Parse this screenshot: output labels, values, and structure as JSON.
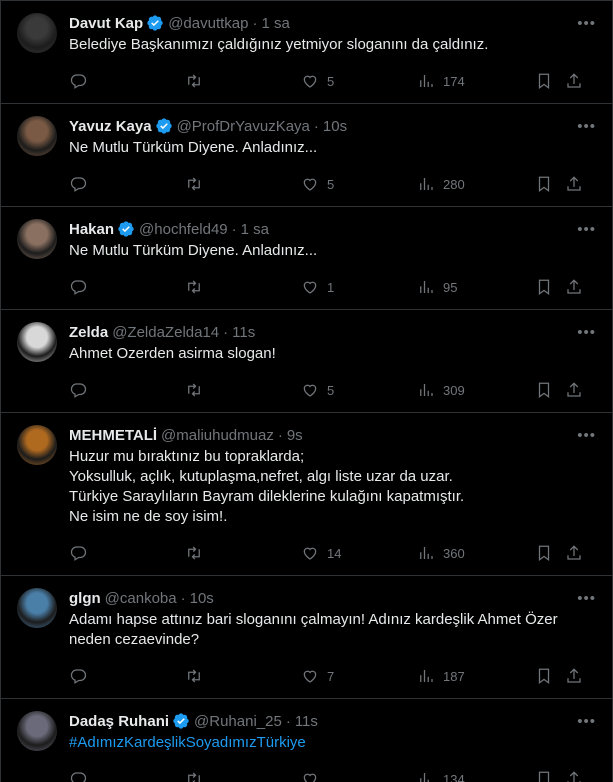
{
  "tweets": [
    {
      "name": "Davut Kap",
      "verified": true,
      "handle": "@davuttkap",
      "time": "1 sa",
      "text": "Belediye Başkanımızı çaldığınız yetmiyor sloganını da çaldınız.",
      "replies": "",
      "retweets": "",
      "likes": "5",
      "views": "174",
      "avatar_color": "#3a3a3a",
      "is_link": false
    },
    {
      "name": "Yavuz Kaya",
      "verified": true,
      "handle": "@ProfDrYavuzKaya",
      "time": "10s",
      "text": "Ne Mutlu Türküm Diyene. Anladınız...",
      "replies": "",
      "retweets": "",
      "likes": "5",
      "views": "280",
      "avatar_color": "#7a5a44",
      "is_link": false
    },
    {
      "name": "Hakan",
      "verified": true,
      "handle": "@hochfeld49",
      "time": "1 sa",
      "text": "Ne Mutlu Türküm Diyene. Anladınız...",
      "replies": "",
      "retweets": "",
      "likes": "1",
      "views": "95",
      "avatar_color": "#8a7060",
      "is_link": false
    },
    {
      "name": "Zelda",
      "verified": false,
      "handle": "@ZeldaZelda14",
      "time": "11s",
      "text": "Ahmet Ozerden asirma slogan!",
      "replies": "",
      "retweets": "",
      "likes": "5",
      "views": "309",
      "avatar_color": "#d8d8d8",
      "is_link": false
    },
    {
      "name": "MEHMETALİ",
      "verified": false,
      "handle": "@maliuhudmuaz",
      "time": "9s",
      "text": "Huzur mu bıraktınız bu topraklarda;\nYoksulluk, açlık, kutuplaşma,nefret, algı liste uzar da uzar.\nTürkiye Saraylıların Bayram dileklerine kulağını kapatmıştır.\nNe isim ne de soy isim!.",
      "replies": "",
      "retweets": "",
      "likes": "14",
      "views": "360",
      "avatar_color": "#b06a20",
      "is_link": false
    },
    {
      "name": "glgn",
      "verified": false,
      "handle": "@cankoba",
      "time": "10s",
      "text": "Adamı hapse attınız bari sloganını çalmayın! Adınız kardeşlik Ahmet Özer neden cezaevinde?",
      "replies": "",
      "retweets": "",
      "likes": "7",
      "views": "187",
      "avatar_color": "#4a7fa8",
      "is_link": false
    },
    {
      "name": "Dadaş Ruhani",
      "verified": true,
      "handle": "@Ruhani_25",
      "time": "11s",
      "text": "#AdımızKardeşlikSoyadımızTürkiye",
      "replies": "",
      "retweets": "",
      "likes": "",
      "views": "134",
      "avatar_color": "#6a6a7a",
      "is_link": true
    }
  ],
  "colors": {
    "background": "#000000",
    "text": "#e7e9ea",
    "muted": "#71767b",
    "accent": "#1d9bf0",
    "border": "#2f3336"
  },
  "icons": [
    "reply-icon",
    "retweet-icon",
    "like-icon",
    "views-icon",
    "bookmark-icon",
    "share-icon",
    "more-icon",
    "verified-icon"
  ]
}
